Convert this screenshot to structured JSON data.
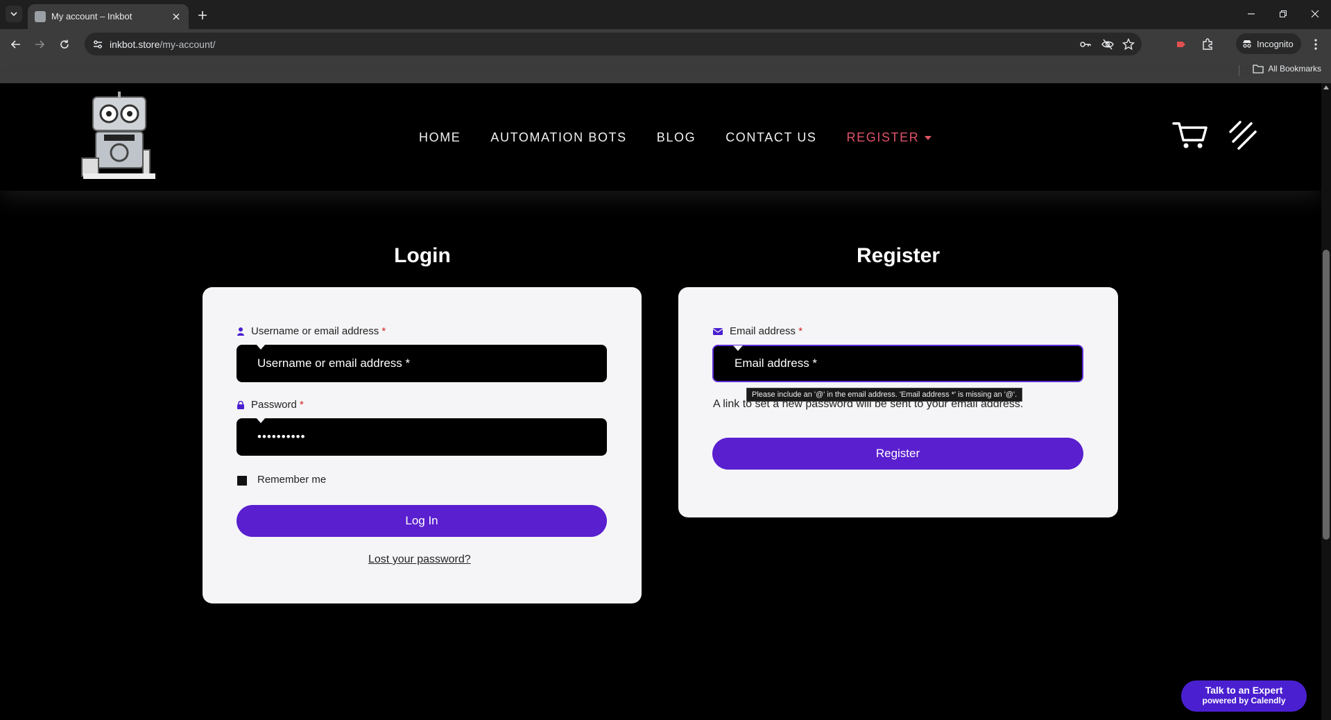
{
  "browser": {
    "tab_title": "My account – Inkbot",
    "url_host": "inkbot.store",
    "url_path": "/my-account/",
    "incognito_label": "Incognito",
    "bookmarks_label": "All Bookmarks"
  },
  "header": {
    "nav": [
      {
        "label": "HOME"
      },
      {
        "label": "AUTOMATION BOTS"
      },
      {
        "label": "BLOG"
      },
      {
        "label": "CONTACT US"
      },
      {
        "label": "REGISTER"
      }
    ]
  },
  "login": {
    "title": "Login",
    "username_label": "Username or email address",
    "username_placeholder": "Username or email address *",
    "password_label": "Password",
    "password_value": "••••••••••",
    "required_mark": "*",
    "remember_label": "Remember me",
    "submit_label": "Log In",
    "lost_password": "Lost your password?"
  },
  "register": {
    "title": "Register",
    "email_label": "Email address",
    "email_placeholder": "Email address *",
    "required_mark": "*",
    "helper_text": "A link to set a new password will be sent to your email address.",
    "validation_tooltip": "Please include an '@' in the email address. 'Email address *' is missing an '@'.",
    "submit_label": "Register"
  },
  "calendly": {
    "line1": "Talk to an Expert",
    "line2": "powered by Calendly"
  },
  "colors": {
    "accent": "#5a1fcf",
    "nav_active": "#e0546a"
  }
}
